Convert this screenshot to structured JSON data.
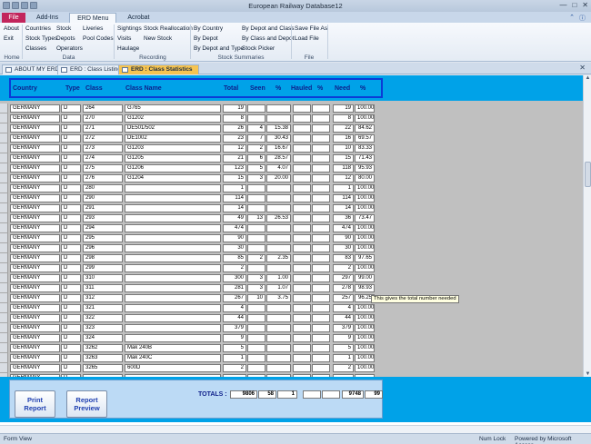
{
  "window": {
    "title": "European Railway Database12"
  },
  "ribbon_tabs": [
    "File",
    "Add-Ins",
    "ERD Menu",
    "Acrobat"
  ],
  "ribbon": {
    "home": {
      "items": [
        "About",
        "Exit"
      ],
      "label": "Home"
    },
    "data": {
      "items": [
        "Countries",
        "Stock",
        "Liveries",
        "Stock Types",
        "Depots",
        "Pool Codes",
        "Classes",
        "Operators"
      ],
      "label": "Data"
    },
    "recording": {
      "items": [
        "Sightings",
        "Stock Reallocation",
        "Visits",
        "New Stock",
        "Haulage"
      ],
      "label": "Recording"
    },
    "stock_summaries": {
      "items": [
        "By Country",
        "By Depot and Class",
        "By Depot",
        "By Class and Depot",
        "By Depot and Type",
        "Stock Picker"
      ],
      "label": "Stock Summaries"
    },
    "file": {
      "items": [
        "Save File As",
        "Load File"
      ],
      "label": "File"
    }
  },
  "doc_tabs": [
    "ABOUT MY ERD",
    "ERD : Class Listing",
    "ERD : Class Statistics"
  ],
  "columns": {
    "country": "Country",
    "type": "Type",
    "class": "Class",
    "class_name": "Class Name",
    "total": "Total",
    "seen": "Seen",
    "seen_pct": "%",
    "hauled": "Hauled",
    "hauled_pct": "%",
    "need": "Need",
    "need_pct": "%"
  },
  "rows": [
    [
      "GERMANY",
      "D",
      "264",
      "G765",
      "19",
      "",
      "",
      "",
      "",
      "19",
      "100.00"
    ],
    [
      "GERMANY",
      "D",
      "270",
      "G1202",
      "8",
      "",
      "",
      "",
      "",
      "8",
      "100.00"
    ],
    [
      "GERMANY",
      "D",
      "271",
      "DE501/502",
      "26",
      "4",
      "15.38",
      "",
      "",
      "22",
      "84.62"
    ],
    [
      "GERMANY",
      "D",
      "272",
      "DE1002",
      "23",
      "7",
      "30.43",
      "",
      "",
      "16",
      "69.57"
    ],
    [
      "GERMANY",
      "D",
      "273",
      "G1203",
      "12",
      "2",
      "16.67",
      "",
      "",
      "10",
      "83.33"
    ],
    [
      "GERMANY",
      "D",
      "274",
      "G1205",
      "21",
      "6",
      "28.57",
      "",
      "",
      "15",
      "71.43"
    ],
    [
      "GERMANY",
      "D",
      "275",
      "G1206",
      "123",
      "5",
      "4.07",
      "",
      "",
      "118",
      "95.93"
    ],
    [
      "GERMANY",
      "D",
      "276",
      "G1204",
      "15",
      "3",
      "20.00",
      "",
      "",
      "12",
      "80.00"
    ],
    [
      "GERMANY",
      "D",
      "280",
      "",
      "1",
      "",
      "",
      "",
      "",
      "1",
      "100.00"
    ],
    [
      "GERMANY",
      "D",
      "290",
      "",
      "114",
      "",
      "",
      "",
      "",
      "114",
      "100.00"
    ],
    [
      "GERMANY",
      "D",
      "291",
      "",
      "14",
      "",
      "",
      "",
      "",
      "14",
      "100.00"
    ],
    [
      "GERMANY",
      "D",
      "293",
      "",
      "49",
      "13",
      "26.53",
      "",
      "",
      "36",
      "73.47"
    ],
    [
      "GERMANY",
      "D",
      "294",
      "",
      "474",
      "",
      "",
      "",
      "",
      "474",
      "100.00"
    ],
    [
      "GERMANY",
      "D",
      "295",
      "",
      "90",
      "",
      "",
      "",
      "",
      "90",
      "100.00"
    ],
    [
      "GERMANY",
      "D",
      "296",
      "",
      "30",
      "",
      "",
      "",
      "",
      "30",
      "100.00"
    ],
    [
      "GERMANY",
      "D",
      "298",
      "",
      "85",
      "2",
      "2.35",
      "",
      "",
      "83",
      "97.65"
    ],
    [
      "GERMANY",
      "D",
      "299",
      "",
      "2",
      "",
      "",
      "",
      "",
      "2",
      "100.00"
    ],
    [
      "GERMANY",
      "D",
      "310",
      "",
      "300",
      "3",
      "1.00",
      "",
      "",
      "297",
      "99.00"
    ],
    [
      "GERMANY",
      "D",
      "311",
      "",
      "281",
      "3",
      "1.07",
      "",
      "",
      "278",
      "98.93"
    ],
    [
      "GERMANY",
      "D",
      "312",
      "",
      "267",
      "10",
      "3.75",
      "",
      "",
      "257",
      "96.25"
    ],
    [
      "GERMANY",
      "D",
      "321",
      "",
      "4",
      "",
      "",
      "",
      "",
      "4",
      "100.00"
    ],
    [
      "GERMANY",
      "D",
      "322",
      "",
      "44",
      "",
      "",
      "",
      "",
      "44",
      "100.00"
    ],
    [
      "GERMANY",
      "D",
      "323",
      "",
      "379",
      "",
      "",
      "",
      "",
      "379",
      "100.00"
    ],
    [
      "GERMANY",
      "D",
      "324",
      "",
      "9",
      "",
      "",
      "",
      "",
      "9",
      "100.00"
    ],
    [
      "GERMANY",
      "D",
      "3262",
      "Mak 240B",
      "5",
      "",
      "",
      "",
      "",
      "5",
      "100.00"
    ],
    [
      "GERMANY",
      "D",
      "3263",
      "Mak 240C",
      "1",
      "",
      "",
      "",
      "",
      "1",
      "100.00"
    ],
    [
      "GERMANY",
      "D",
      "3265",
      "600D",
      "2",
      "",
      "",
      "",
      "",
      "2",
      "100.00"
    ],
    [
      "GERMANY",
      "D",
      "",
      "",
      "",
      "",
      "",
      "",
      "",
      "",
      ""
    ]
  ],
  "tooltip": "This gives the total number needed",
  "footer": {
    "print_report": "Print Report",
    "report_preview": "Report Preview",
    "totals_label": "TOTALS :",
    "totals": {
      "total": "9806",
      "seen": "58",
      "seen_pct": "1",
      "hauled": "",
      "hauled_pct": "",
      "need": "9748",
      "need_pct": "99"
    }
  },
  "status": {
    "view": "Form View",
    "num_lock": "Num Lock",
    "powered": "Powered by Microsoft Access"
  }
}
